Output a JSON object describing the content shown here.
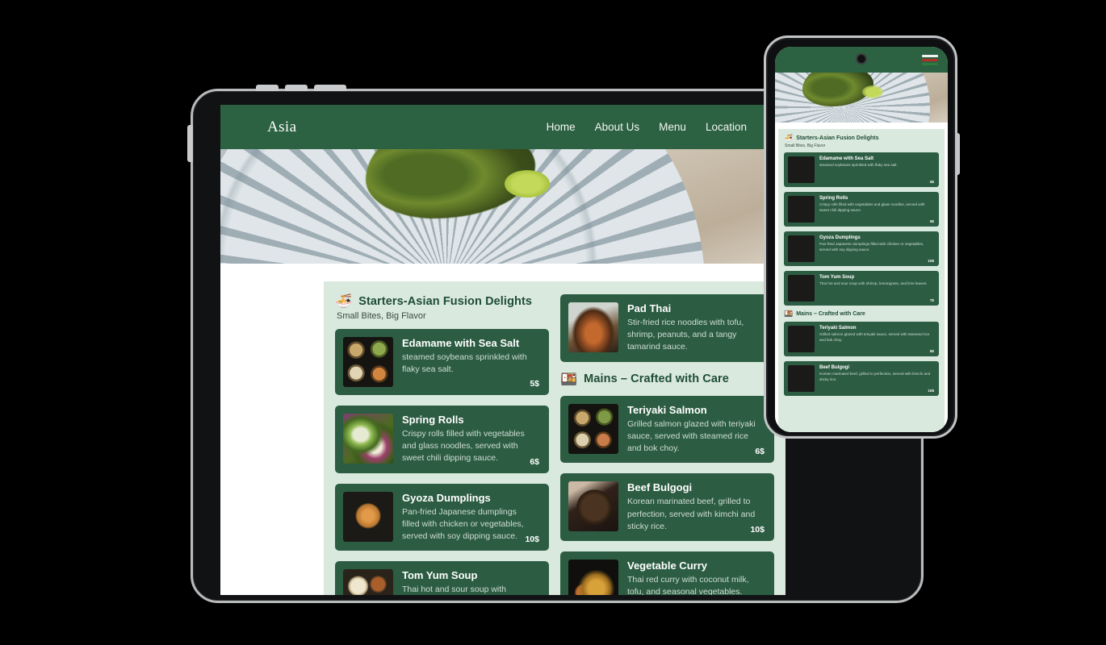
{
  "site": {
    "brand": "Asia",
    "nav": [
      {
        "label": "Home"
      },
      {
        "label": "About Us"
      },
      {
        "label": "Menu"
      },
      {
        "label": "Location"
      }
    ],
    "menu_icon": "hamburger-menu-icon",
    "camera_icon": "front-camera-icon"
  },
  "colors": {
    "brand_green": "#2c6141",
    "card_green": "#2c5c42",
    "panel_bg": "#d9e9de",
    "page_white": "#ffffff",
    "heading_green": "#1f4d33"
  },
  "sections": [
    {
      "emoji": "🍜",
      "emoji_name": "steaming-bowl-icon",
      "title": "Starters-Asian Fusion Delights",
      "subtitle": "Small Bites, Big Flavor"
    },
    {
      "emoji": "🍱",
      "emoji_name": "takeout-box-icon",
      "title": "Mains – Crafted with Care",
      "subtitle": ""
    }
  ],
  "items": {
    "edamame": {
      "title": "Edamame with Sea Salt",
      "desc": "steamed soybeans sprinkled with flaky sea salt.",
      "price": "5$"
    },
    "spring_rolls": {
      "title": "Spring Rolls",
      "desc": "Crispy rolls filled with vegetables and glass noodles, served with sweet chili dipping sauce.",
      "price": "6$"
    },
    "gyoza": {
      "title": "Gyoza Dumplings",
      "desc": "Pan-fried Japanese dumplings filled with chicken or vegetables, served with soy dipping sauce.",
      "price": "10$"
    },
    "tom_yum": {
      "title": "Tom Yum Soup",
      "desc": "Thai hot and sour soup with shrimp, lemongrass, and lime leaves.",
      "price": "7$"
    },
    "pad_thai": {
      "title": "Pad Thai",
      "desc": "Stir-fried rice noodles with tofu, shrimp, peanuts, and a tangy tamarind sauce.",
      "price": ""
    },
    "teriyaki": {
      "title": "Teriyaki Salmon",
      "desc": "Grilled salmon glazed with teriyaki sauce, served with steamed rice and bok choy.",
      "price": "6$"
    },
    "bulgogi": {
      "title": "Beef Bulgogi",
      "desc": "Korean marinated beef, grilled to perfection, served with kimchi and sticky rice.",
      "price": "10$"
    },
    "veg_curry": {
      "title": "Vegetable Curry",
      "desc": "Thai red curry with coconut milk, tofu, and seasonal vegetables.",
      "price": ""
    }
  }
}
